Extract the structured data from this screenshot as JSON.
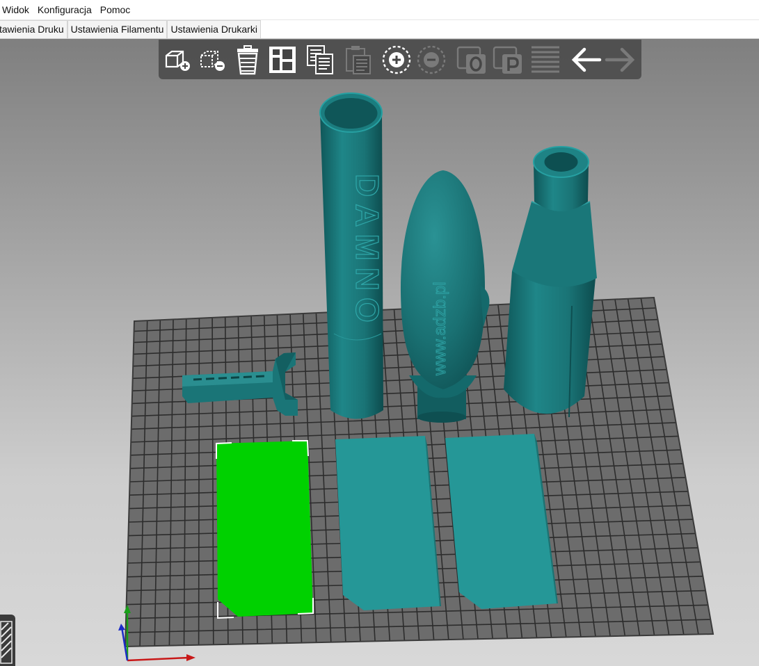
{
  "menu": {
    "items": [
      {
        "label": "Widok"
      },
      {
        "label": "Konfiguracja"
      },
      {
        "label": "Pomoc"
      }
    ]
  },
  "tabs": [
    {
      "label": "tawienia Druku"
    },
    {
      "label": "Ustawienia Filamentu"
    },
    {
      "label": "Ustawienia Drukarki"
    }
  ],
  "toolbar": {
    "buttons": [
      {
        "name": "add",
        "icon": "add-object-icon",
        "enabled": true
      },
      {
        "name": "delete",
        "icon": "delete-object-icon",
        "enabled": true
      },
      {
        "name": "delete-all",
        "icon": "delete-all-icon",
        "enabled": true
      },
      {
        "name": "arrange",
        "icon": "arrange-icon",
        "enabled": true
      },
      {
        "name": "copy",
        "icon": "copy-icon",
        "enabled": true
      },
      {
        "name": "paste",
        "icon": "paste-icon",
        "enabled": false
      },
      {
        "name": "add-instance",
        "icon": "add-instance-icon",
        "enabled": true
      },
      {
        "name": "remove-instance",
        "icon": "remove-instance-icon",
        "enabled": false
      },
      {
        "name": "split-objects",
        "icon": "split-objects-icon",
        "enabled": false
      },
      {
        "name": "split-parts",
        "icon": "split-parts-icon",
        "enabled": false
      },
      {
        "name": "layers",
        "icon": "layers-editing-icon",
        "enabled": false
      },
      {
        "name": "undo",
        "icon": "undo-arrow-icon",
        "enabled": true
      },
      {
        "name": "redo",
        "icon": "redo-arrow-icon",
        "enabled": false
      }
    ]
  },
  "scene": {
    "objects": [
      {
        "name": "tube-body",
        "engraved_text": "DAMNO"
      },
      {
        "name": "nose-cone",
        "engraved_text": "www.adzb.pl"
      },
      {
        "name": "nozzle-body"
      },
      {
        "name": "launch-lug"
      },
      {
        "name": "fin-1",
        "selected": true
      },
      {
        "name": "fin-2"
      },
      {
        "name": "fin-3"
      }
    ]
  },
  "colors": {
    "model": "#1d7c7e",
    "model_dark": "#125a5c",
    "fin": "#279a9a",
    "selected": "#00d100",
    "bed": "#6e6e6e",
    "grid": "#2e2e2e",
    "toolbar_bg": "#464646"
  }
}
